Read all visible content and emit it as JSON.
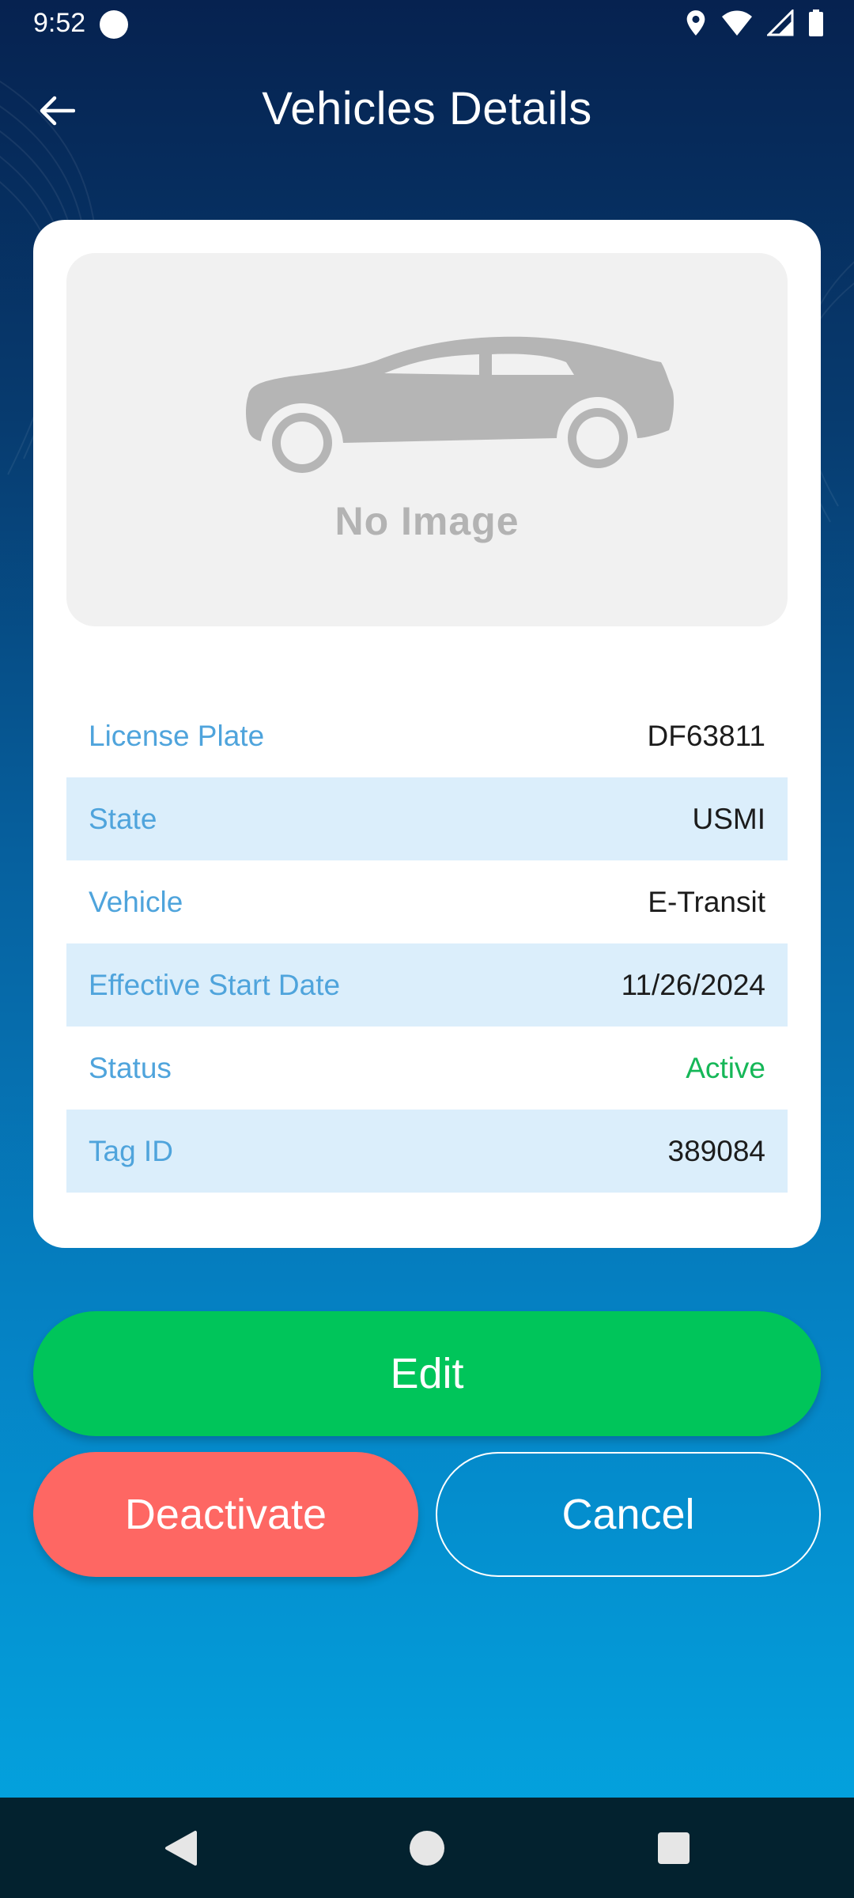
{
  "status_bar": {
    "time": "9:52"
  },
  "app_bar": {
    "title": "Vehicles Details"
  },
  "image_placeholder": {
    "label": "No Image"
  },
  "details": [
    {
      "label": "License Plate",
      "value": "DF63811"
    },
    {
      "label": "State",
      "value": "USMI"
    },
    {
      "label": "Vehicle",
      "value": "E-Transit"
    },
    {
      "label": "Effective Start Date",
      "value": "11/26/2024"
    },
    {
      "label": "Status",
      "value": "Active"
    },
    {
      "label": "Tag ID",
      "value": "389084"
    }
  ],
  "buttons": {
    "edit": "Edit",
    "deactivate": "Deactivate",
    "cancel": "Cancel"
  },
  "colors": {
    "edit": "#00c55a",
    "deactivate": "#fe6763",
    "status_active": "#16b758",
    "label": "#4fa4dc",
    "row_alt": "#dbeefb"
  },
  "icons": {
    "back": "arrow-left-icon",
    "placeholder": "car-icon",
    "location": "location-pin-icon",
    "wifi": "wifi-icon",
    "signal": "cell-signal-icon",
    "battery": "battery-icon"
  }
}
